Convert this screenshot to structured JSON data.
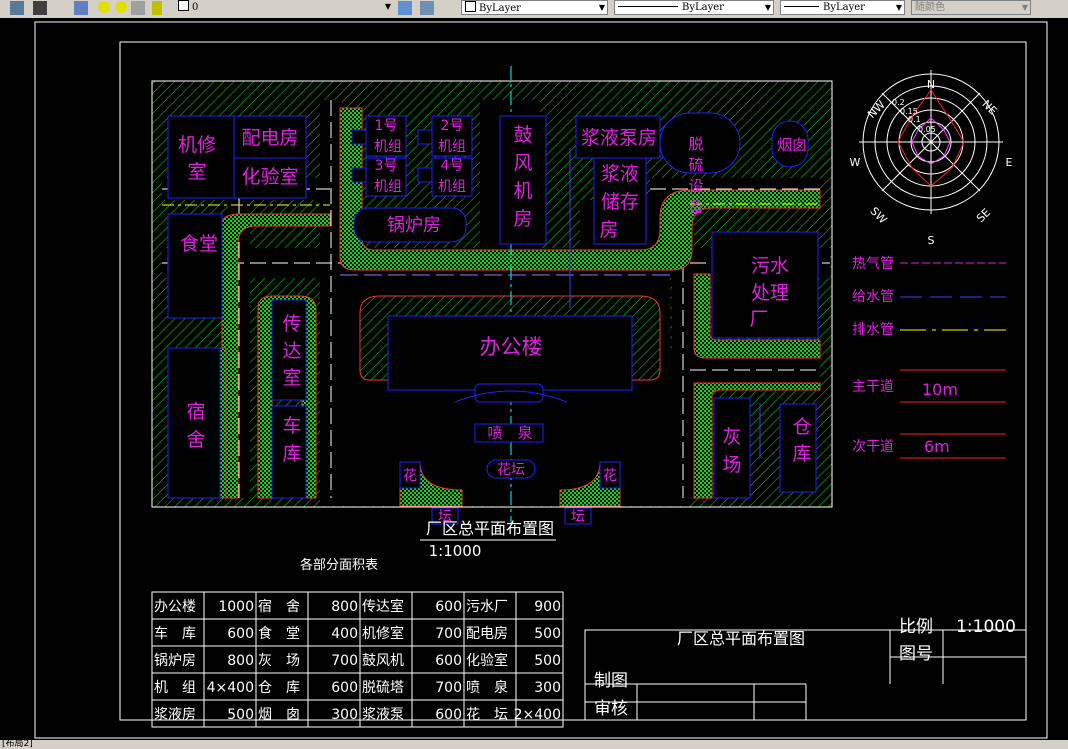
{
  "toolbar": {
    "layer_value": "0",
    "color_value": "ByLayer",
    "linetype_value": "ByLayer",
    "lineweight_value": "ByLayer",
    "plotstyle_value": "随颜色"
  },
  "status": {
    "layout_tab": "[布局2]"
  },
  "plan": {
    "buildings": {
      "jixiu": [
        "机修",
        "室"
      ],
      "peidian": "配电房",
      "huayan": "化验室",
      "shitang": "食堂",
      "sushe": [
        "宿",
        "舍"
      ],
      "chuanda": [
        "传",
        "达",
        "室"
      ],
      "cheku": [
        "车",
        "库"
      ],
      "jizu1": [
        "1号",
        "机组"
      ],
      "jizu2": [
        "2号",
        "机组"
      ],
      "jizu3": [
        "3号",
        "机组"
      ],
      "jizu4": [
        "4号",
        "机组"
      ],
      "guolu": "锅炉房",
      "gufeng": [
        "鼓",
        "风",
        "机",
        "房"
      ],
      "jiangye_beng": "浆液泵房",
      "jiangye_chu": [
        "浆液",
        "储存",
        "房"
      ],
      "tuoliu": [
        "脱",
        "硫",
        "设",
        "备"
      ],
      "yancong": "烟囱",
      "wushui": [
        "污水",
        "处理",
        "厂"
      ],
      "bangong": "办公楼",
      "penquan": "喷　泉",
      "huatan_c": "花坛",
      "hua": "花",
      "tan": "坛",
      "huichang": [
        "灰",
        "场"
      ],
      "cangku": [
        "仓",
        "库"
      ]
    },
    "title": "厂区总平面布置图",
    "scale": "1:1000",
    "compass": {
      "n": "N",
      "s": "S",
      "e": "E",
      "w": "W",
      "ne": "NE",
      "nw": "NW",
      "se": "SE",
      "sw": "SW",
      "rings": [
        "0.2",
        "0.15",
        "0.1",
        "0.05"
      ]
    }
  },
  "legend": {
    "hot": "热气管",
    "water": "给水管",
    "drain": "排水管",
    "main_road": "主干道",
    "main_road_w": "10m",
    "sec_road": "次干道",
    "sec_road_w": "6m"
  },
  "area_table": {
    "title": "各部分面积表",
    "rows": [
      [
        "办公楼",
        "1000",
        "宿　舍",
        "800",
        "传达室",
        "600",
        "污水厂",
        "900"
      ],
      [
        "车　库",
        "600",
        "食　堂",
        "400",
        "机修室",
        "700",
        "配电房",
        "500"
      ],
      [
        "锅炉房",
        "800",
        "灰　场",
        "700",
        "鼓风机",
        "600",
        "化验室",
        "500"
      ],
      [
        "机　组",
        "4×400",
        "仓　库",
        "600",
        "脱硫塔",
        "700",
        "喷　泉",
        "300"
      ],
      [
        "浆液房",
        "500",
        "烟　囱",
        "300",
        "浆液泵",
        "600",
        "花　坛",
        "2×400"
      ]
    ]
  },
  "title_block": {
    "title": "厂区总平面布置图",
    "scale_label": "比例",
    "scale_value": "1:1000",
    "drawing_no_label": "图号",
    "drawn_by_label": "制图",
    "checked_by_label": "审核"
  },
  "colors": {
    "building": "#0000ff",
    "label": "#e020e0",
    "road": "#ffffff",
    "green": "#00ff00",
    "red": "#ff0000",
    "canvas": "#000000"
  }
}
